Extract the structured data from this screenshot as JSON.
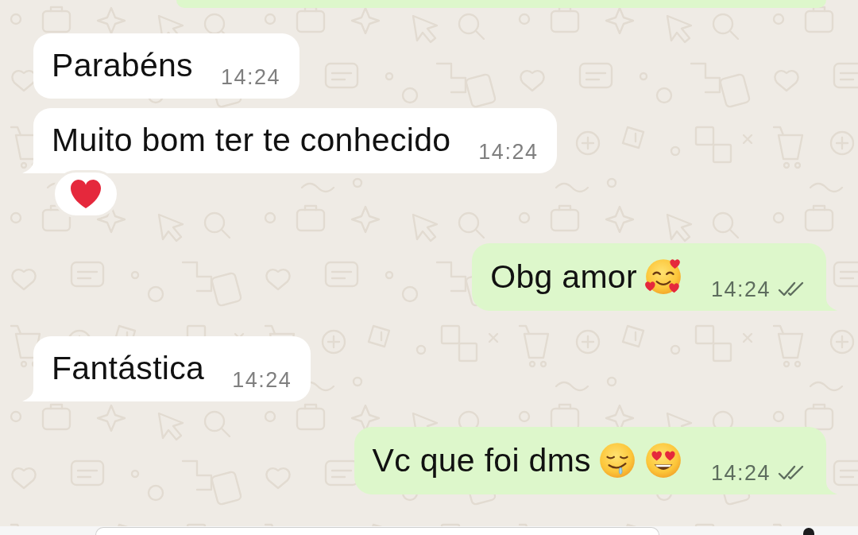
{
  "messages": [
    {
      "outgoing": true,
      "kind": "cut"
    },
    {
      "outgoing": false,
      "kind": "text",
      "text": "Parabéns",
      "time": "14:24"
    },
    {
      "outgoing": false,
      "kind": "text",
      "text": "Muito bom ter te conhecido",
      "time": "14:24",
      "reactions": [
        {
          "kind": "red-heart"
        }
      ]
    },
    {
      "outgoing": true,
      "kind": "text",
      "text": "Obg amor",
      "emojis": [
        {
          "kind": "smiling-face-with-hearts"
        }
      ],
      "time": "14:24",
      "read": false
    },
    {
      "outgoing": false,
      "kind": "text",
      "text": "Fantástica",
      "time": "14:24"
    },
    {
      "outgoing": true,
      "kind": "text",
      "text": "Vc que foi dms",
      "emojis": [
        {
          "kind": "drooling-face"
        },
        {
          "kind": "smiling-face-with-heart-eyes"
        }
      ],
      "time": "14:24",
      "read": false
    }
  ]
}
